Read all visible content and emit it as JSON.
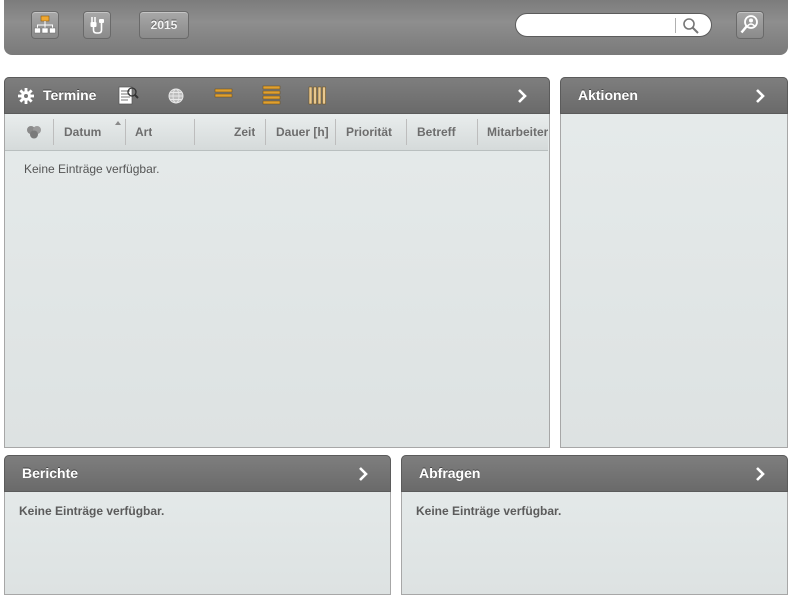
{
  "toolbar": {
    "year_label": "2015",
    "search_placeholder": "",
    "search_value": ""
  },
  "termine": {
    "title": "Termine",
    "columns": [
      "Datum",
      "Art",
      "Zeit",
      "Dauer [h]",
      "Priorität",
      "Betreff",
      "Mitarbeiter"
    ],
    "empty_text": "Keine Einträge verfügbar."
  },
  "aktionen": {
    "title": "Aktionen"
  },
  "berichte": {
    "title": "Berichte",
    "empty_text": "Keine Einträge verfügbar."
  },
  "abfragen": {
    "title": "Abfragen",
    "empty_text": "Keine Einträge verfügbar."
  },
  "colors": {
    "toolbar_bg": "#828282",
    "panel_header_bg": "#747474",
    "panel_body_bg": "#e2e7e7",
    "accent_orange": "#e0a030"
  }
}
